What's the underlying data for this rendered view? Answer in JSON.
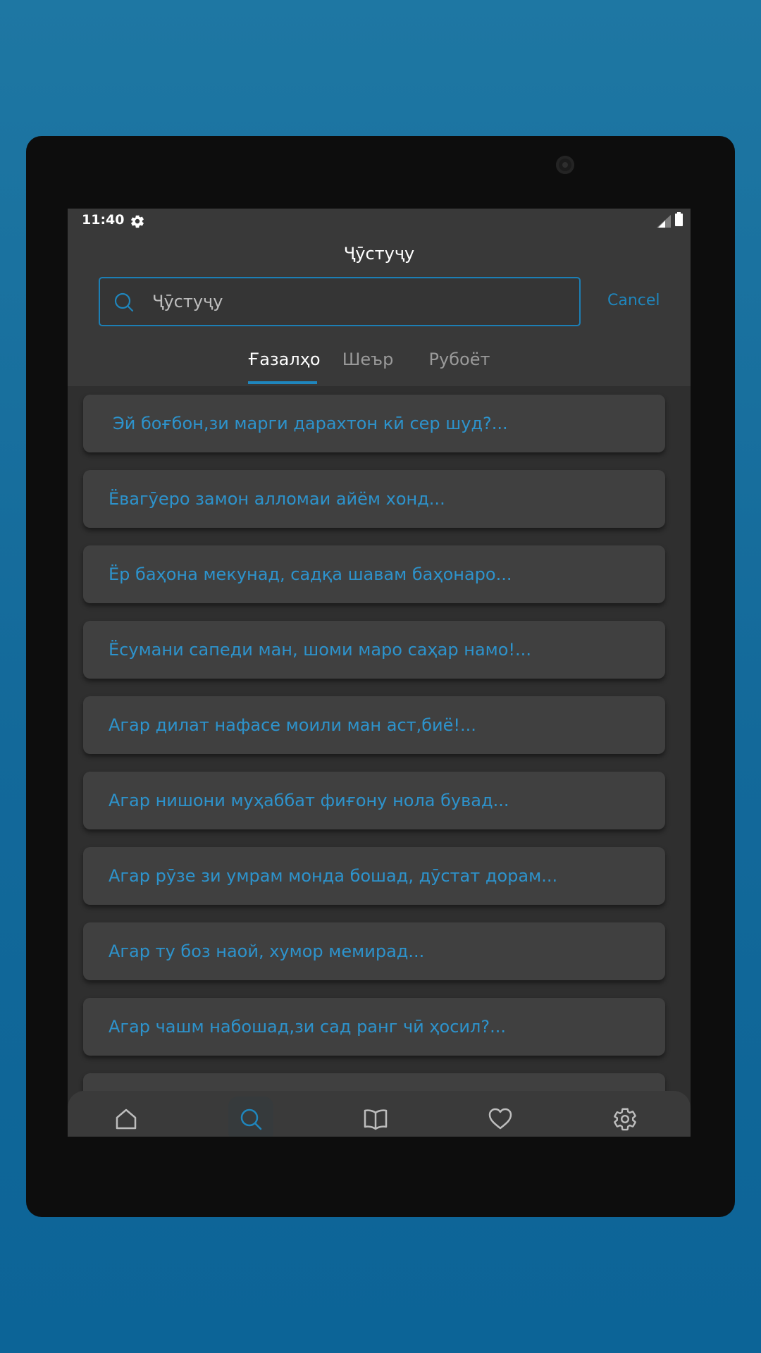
{
  "status_bar": {
    "time": "11:40",
    "settings_icon": "gear-icon",
    "signal_icon": "cell-signal-icon",
    "battery_icon": "battery-icon"
  },
  "header": {
    "title": "Ҷӯстуҷу",
    "search": {
      "placeholder": "Ҷӯстуҷу",
      "value": "",
      "icon": "search-icon"
    },
    "cancel_label": "Cancel"
  },
  "tabs": [
    {
      "label": "Ғазалҳо",
      "active": true
    },
    {
      "label": "Шеър",
      "active": false
    },
    {
      "label": "Рубоёт",
      "active": false
    }
  ],
  "results": [
    "Эй боғбон,зи марги дарахтон кӣ сер шуд?...",
    "Ёвагӯеро замон алломаи айём хонд...",
    "Ёр баҳона мекунад, садқа шавам баҳонаро...",
    "Ёсумани сапеди ман, шоми маро саҳар намо!...",
    "Агар дилат нафасе моили ман аст,биё!...",
    "Агар нишони муҳаббат фиғону нола бувад...",
    "Агар рӯзе зи умрам монда бошад, дӯстат дорам...",
    "Агар ту боз наой, хумор мемирад...",
    "Агар чашм набошад,зи сад ранг чӣ ҳосил?..."
  ],
  "bottom_nav": [
    {
      "icon": "home-icon",
      "active": false
    },
    {
      "icon": "search-icon",
      "active": true
    },
    {
      "icon": "book-icon",
      "active": false
    },
    {
      "icon": "heart-icon",
      "active": false
    },
    {
      "icon": "gear-icon",
      "active": false
    }
  ],
  "system_nav": [
    "back-triangle-icon",
    "home-circle-icon",
    "recents-square-icon"
  ],
  "colors": {
    "background": "#1a72a0",
    "screen": "#2f2f2f",
    "header": "#393939",
    "card": "#404040",
    "accent": "#1f86bd",
    "result_text": "#2d93cc"
  }
}
